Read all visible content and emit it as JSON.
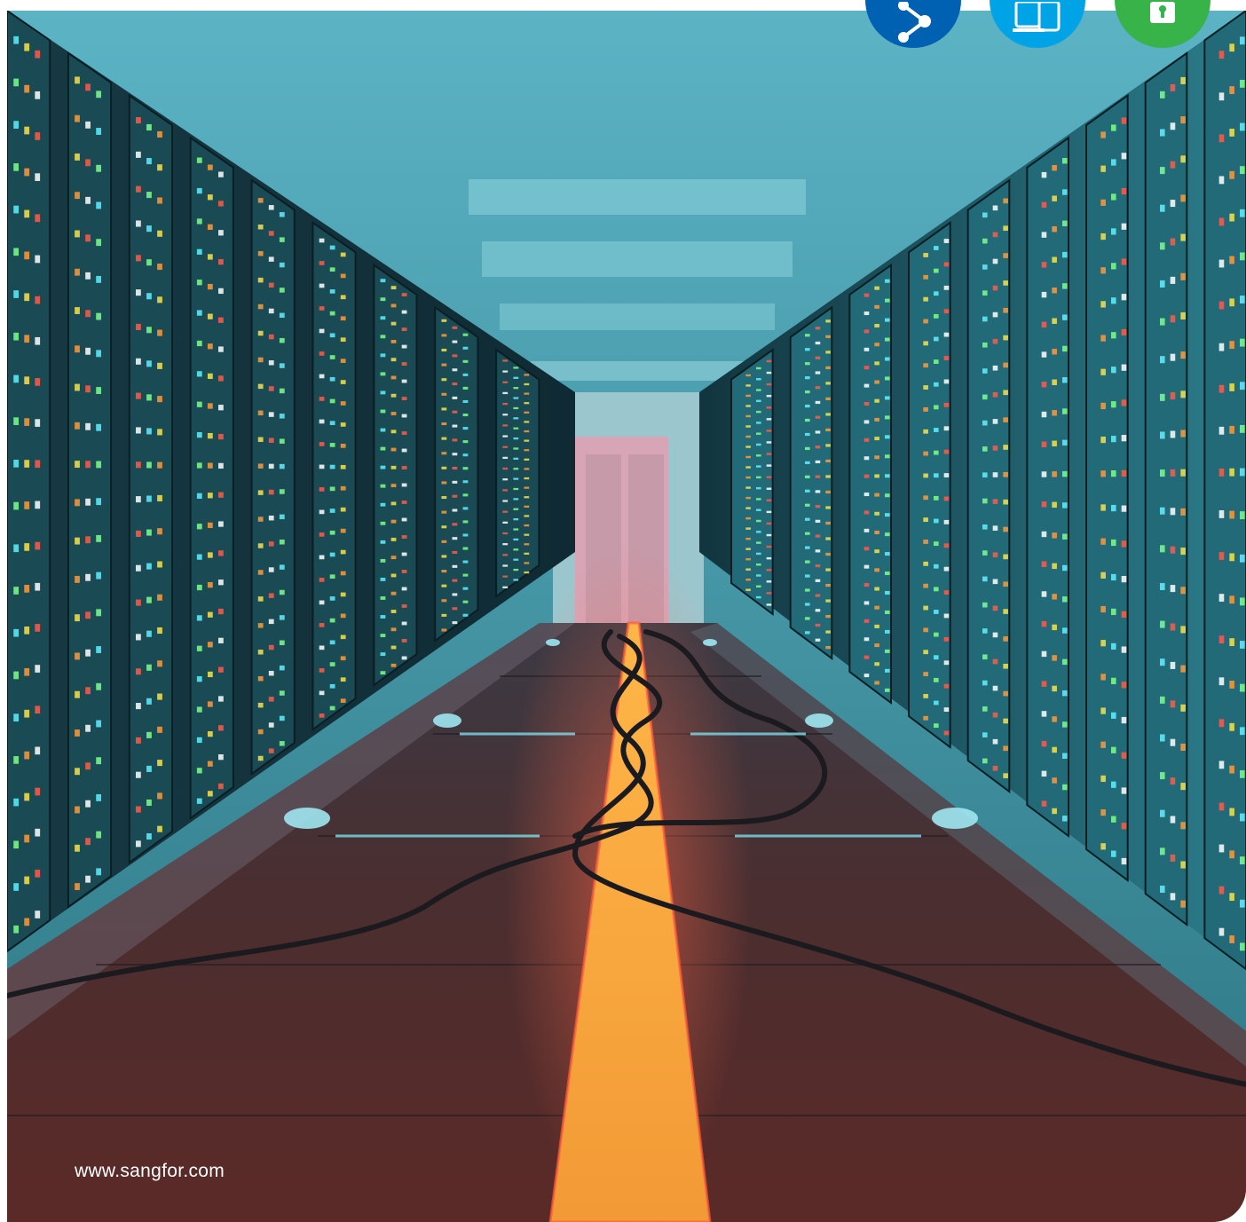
{
  "footer": {
    "website": "www.sangfor.com"
  },
  "badges": [
    {
      "icon": "share-icon",
      "color": "#0060b1"
    },
    {
      "icon": "devices-icon",
      "color": "#00a3e6"
    },
    {
      "icon": "lock-icon",
      "color": "#37b34a"
    }
  ],
  "colors": {
    "floor_light_strip": "#f4a03a",
    "server_glow": "#46c4d2"
  }
}
